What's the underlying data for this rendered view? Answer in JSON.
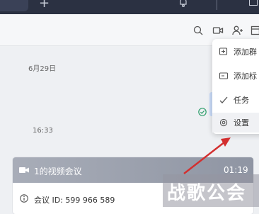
{
  "topbar": {
    "plus_symbol": "+"
  },
  "toolbar": {
    "icons": [
      "search-icon",
      "video-call-icon",
      "add-member-icon",
      "more-icon"
    ]
  },
  "chat": {
    "date_label": "6月29日",
    "time_label": "16:33",
    "meeting_card": {
      "title": "1的视频会议",
      "duration": "01:19",
      "meeting_id": "会议 ID: 599 966 589"
    }
  },
  "menu": {
    "items": [
      {
        "label": "添加群",
        "icon": "add-group-icon"
      },
      {
        "label": "添加标",
        "icon": "add-tag-icon"
      },
      {
        "label": "任务",
        "icon": "task-icon"
      },
      {
        "label": "设置",
        "icon": "settings-gear-icon"
      }
    ]
  },
  "annotation": {
    "arrow_color": "#d32f2f"
  },
  "watermark": {
    "text": "战歌公会"
  }
}
